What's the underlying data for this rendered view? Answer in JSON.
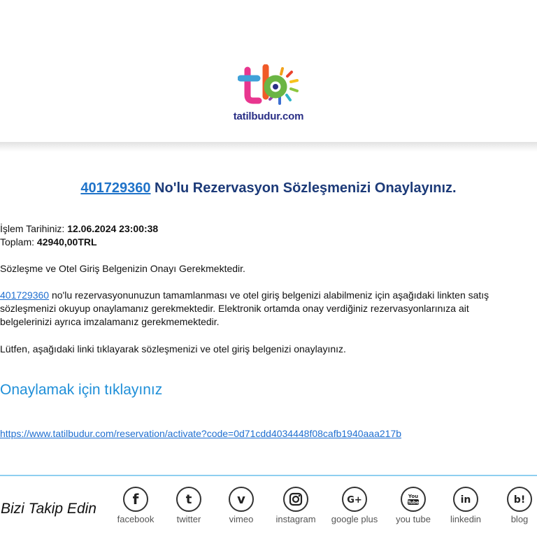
{
  "header": {
    "brand_text": "tatilbudur.com"
  },
  "title": {
    "reservation_no": "401729360",
    "text": " No'lu Rezervasyon Sözleşmenizi Onaylayınız."
  },
  "transaction": {
    "date_label": "İşlem Tarihiniz: ",
    "date_value": "12.06.2024 23:00:38",
    "total_label": "Toplam: ",
    "total_value": "42940,00TRL"
  },
  "notice": "Sözleşme ve Otel Giriş Belgenizin Onayı Gerekmektedir.",
  "body": {
    "reservation_link": "401729360",
    "line1_rest": " no'lu rezervasyonunuzun tamamlanması ve otel giriş belgenizi alabilmeniz için aşağıdaki linkten satış",
    "line2": "sözleşmenizi okuyup onaylamanız gerekmektedir. Elektronik ortamda onay verdiğiniz rezervasyonlarınıza ait",
    "line3": "belgelerinizi ayrıca imzalamanız gerekmemektedir."
  },
  "instruction": "Lütfen, aşağıdaki linki tıklayarak sözleşmenizi ve otel giriş belgenizi onaylayınız.",
  "confirm_label": "Onaylamak için tıklayınız",
  "activation_url": "https://www.tatilbudur.com/reservation/activate?code=0d71cdd4034448f08cafb1940aaa217b",
  "footer": {
    "follow_label": "Bizi Takip Edin",
    "social": [
      {
        "label": "facebook",
        "icon": "facebook-icon"
      },
      {
        "label": "twitter",
        "icon": "twitter-icon"
      },
      {
        "label": "vimeo",
        "icon": "vimeo-icon"
      },
      {
        "label": "instagram",
        "icon": "instagram-icon"
      },
      {
        "label": "google plus",
        "icon": "google-plus-icon"
      },
      {
        "label": "you tube",
        "icon": "youtube-icon"
      },
      {
        "label": "linkedin",
        "icon": "linkedin-icon"
      },
      {
        "label": "blog",
        "icon": "blog-icon"
      }
    ]
  },
  "colors": {
    "title": "#1c3a78",
    "link": "#1f6fd0",
    "confirm_link": "#1f8fd8",
    "divider": "#8ecff0",
    "brand_text": "#2a2f86"
  }
}
